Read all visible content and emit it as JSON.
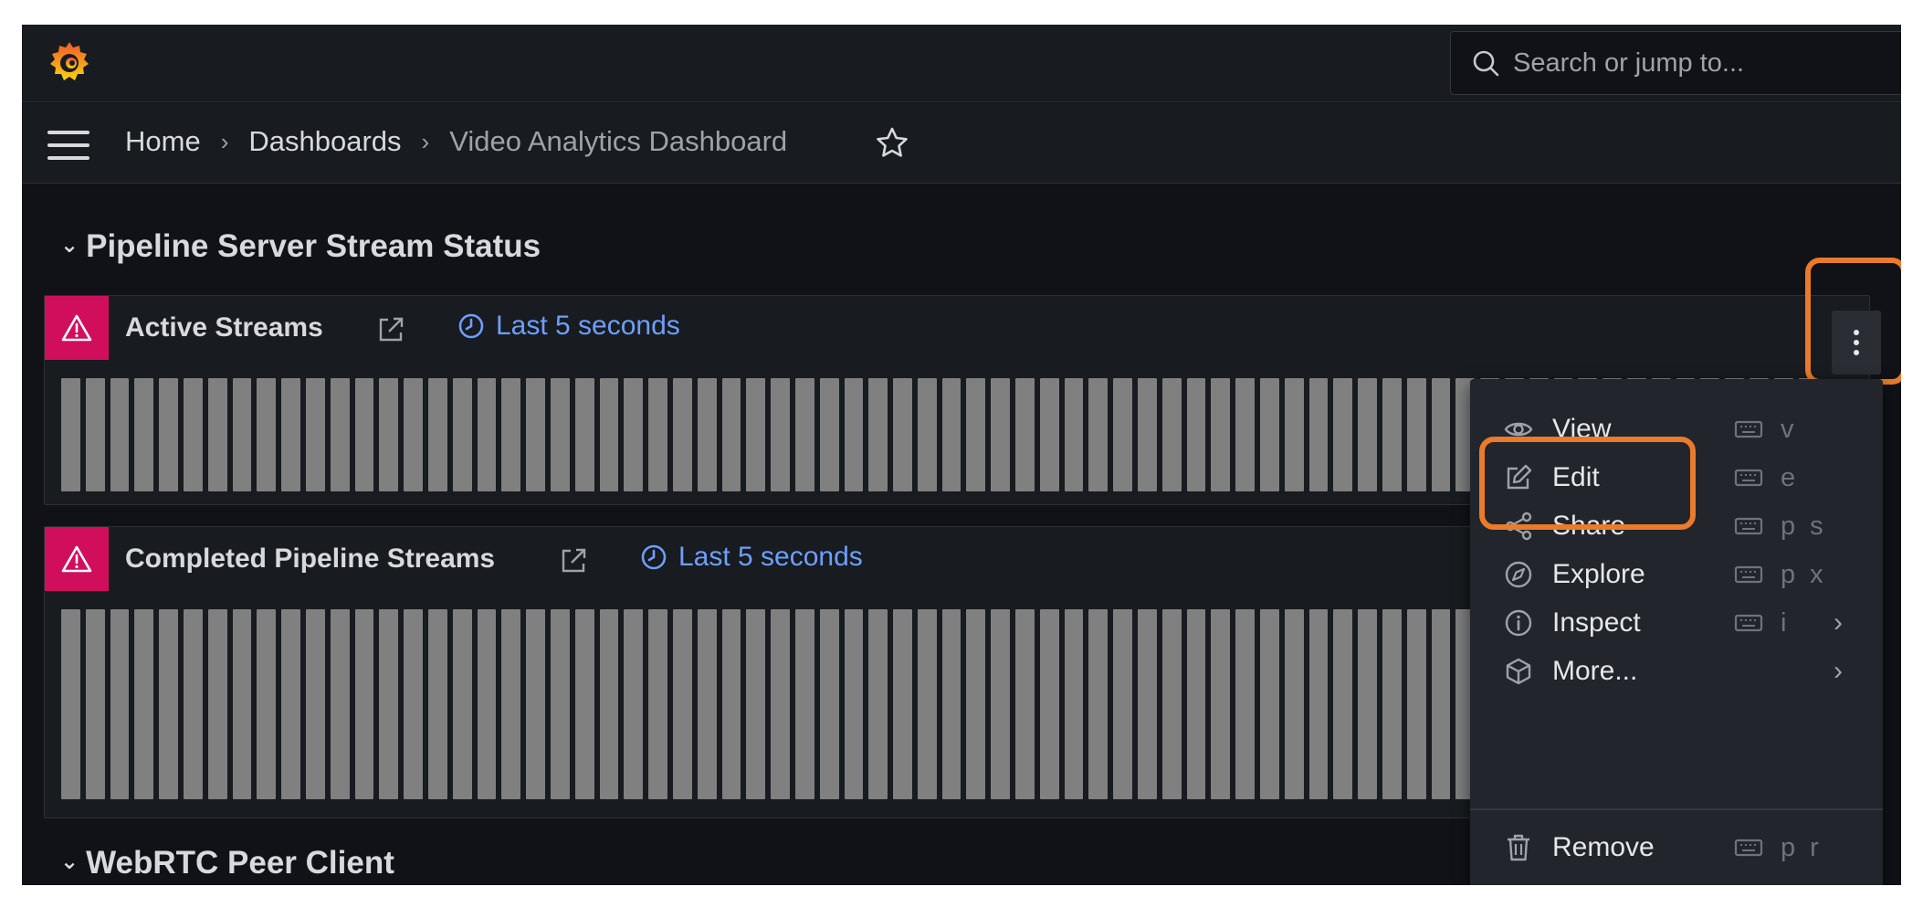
{
  "search": {
    "placeholder": "Search or jump to..."
  },
  "breadcrumb": {
    "home": "Home",
    "dashboards": "Dashboards",
    "current": "Video Analytics Dashboard"
  },
  "rows": [
    {
      "title": "Pipeline Server Stream Status"
    },
    {
      "title": "WebRTC Peer Client"
    }
  ],
  "panels": [
    {
      "title": "Active Streams",
      "time": "Last 5 seconds"
    },
    {
      "title": "Completed Pipeline Streams",
      "time": "Last 5 seconds"
    }
  ],
  "menu": {
    "items": [
      {
        "label": "View",
        "key": "v",
        "icon": "eye-icon"
      },
      {
        "label": "Edit",
        "key": "e",
        "icon": "edit-icon"
      },
      {
        "label": "Share",
        "key": "p s",
        "icon": "share-icon"
      },
      {
        "label": "Explore",
        "key": "p x",
        "icon": "compass-icon"
      },
      {
        "label": "Inspect",
        "key": "i",
        "icon": "info-icon",
        "submenu": true
      },
      {
        "label": "More...",
        "key": "",
        "icon": "cube-icon",
        "submenu": true
      },
      {
        "label": "Remove",
        "key": "p r",
        "icon": "trash-icon"
      }
    ]
  },
  "colors": {
    "background": "#111217",
    "panel": "#181b1f",
    "alert": "#d10e5c",
    "link": "#6e9fff",
    "highlight": "#ea7a2c",
    "bar": "#808080"
  }
}
